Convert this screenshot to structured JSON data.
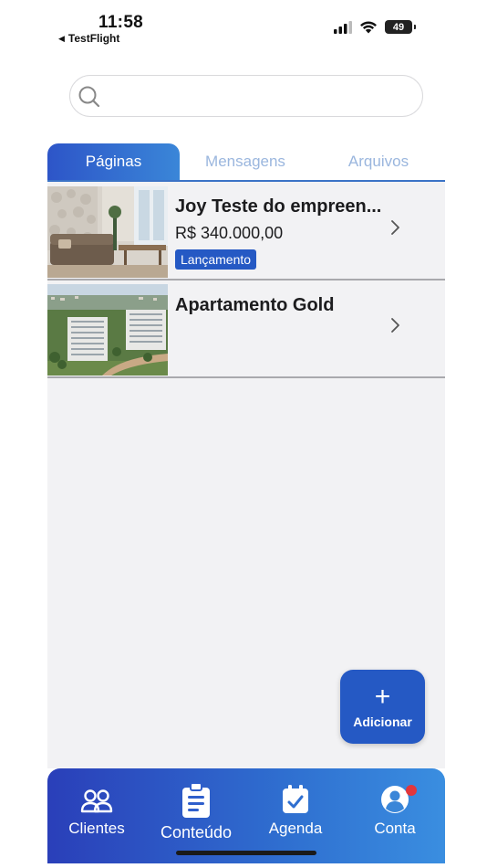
{
  "status_bar": {
    "time": "11:58",
    "back_app": "TestFlight",
    "battery": "49"
  },
  "search": {
    "placeholder": "",
    "value": ""
  },
  "tabs": [
    {
      "label": "Páginas",
      "active": true
    },
    {
      "label": "Mensagens",
      "active": false
    },
    {
      "label": "Arquivos",
      "active": false
    }
  ],
  "items": [
    {
      "title": "Joy Teste do empreen...",
      "price": "R$ 340.000,00",
      "badge": "Lançamento"
    },
    {
      "title": "Apartamento Gold"
    }
  ],
  "fab": {
    "icon": "+",
    "label": "Adicionar"
  },
  "nav": [
    {
      "label": "Clientes",
      "icon": "users-icon"
    },
    {
      "label": "Conteúdo",
      "icon": "clipboard-list-icon",
      "active": true
    },
    {
      "label": "Agenda",
      "icon": "calendar-check-icon"
    },
    {
      "label": "Conta",
      "icon": "user-circle-icon"
    }
  ],
  "colors": {
    "accent": "#2559c4",
    "badge_notification": "#e2363b",
    "list_background": "#f2f2f4"
  }
}
